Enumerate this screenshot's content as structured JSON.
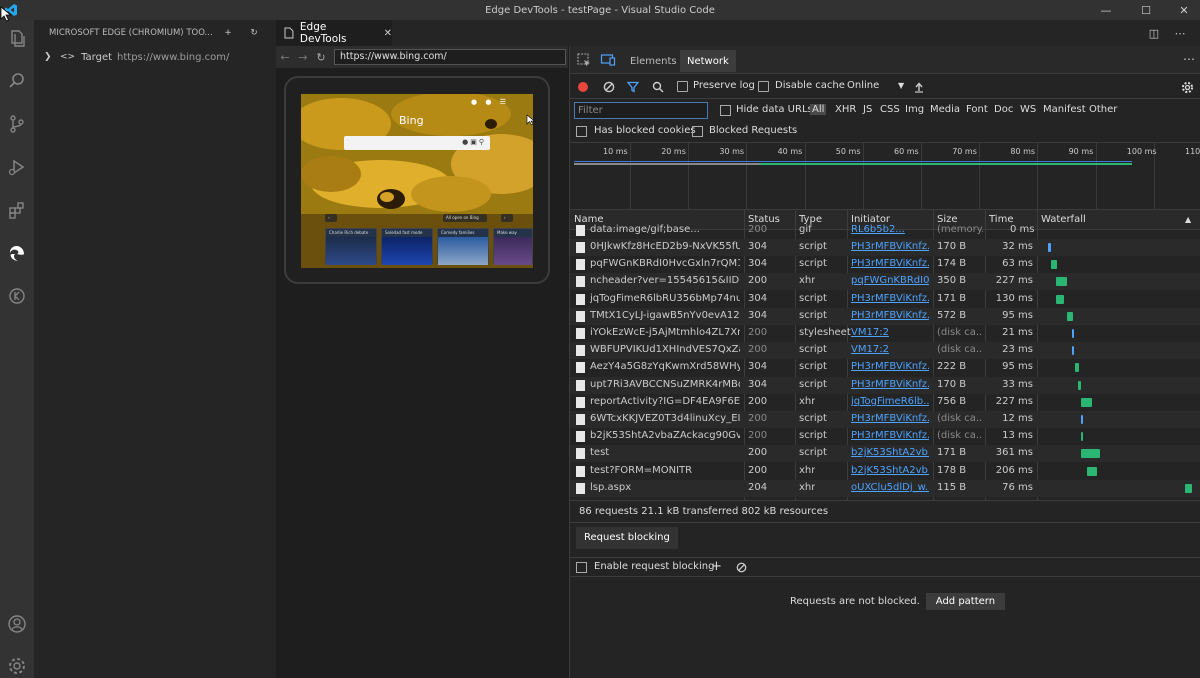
{
  "window": {
    "title": "Edge DevTools - testPage - Visual Studio Code"
  },
  "sidebar": {
    "title": "MICROSOFT EDGE (CHROMIUM) TOO...",
    "target_label": "Target",
    "target_url": "https://www.bing.com/"
  },
  "editor": {
    "tab_label": "Edge DevTools"
  },
  "screencast": {
    "url": "https://www.bing.com/",
    "bing_label": "Bing",
    "tiles": [
      "Charlie Rich debate",
      "Soledad fast mode",
      "Comedy families",
      "Make way"
    ],
    "strip_label": "All open on Bing"
  },
  "devtools": {
    "tabs": [
      {
        "label": "Elements"
      },
      {
        "label": "Network"
      }
    ],
    "toolbar": {
      "preserve_log": "Preserve log",
      "disable_cache": "Disable cache",
      "throttle": "Online"
    },
    "filter": {
      "placeholder": "Filter",
      "hide_data_urls": "Hide data URLs",
      "types": [
        "All",
        "XHR",
        "JS",
        "CSS",
        "Img",
        "Media",
        "Font",
        "Doc",
        "WS",
        "Manifest",
        "Other"
      ],
      "has_blocked_cookies": "Has blocked cookies",
      "blocked_requests": "Blocked Requests"
    },
    "overview_ticks": [
      "10 ms",
      "20 ms",
      "30 ms",
      "40 ms",
      "50 ms",
      "60 ms",
      "70 ms",
      "80 ms",
      "90 ms",
      "100 ms",
      "110"
    ],
    "table": {
      "columns": [
        "Name",
        "Status",
        "Type",
        "Initiator",
        "Size",
        "Time",
        "Waterfall"
      ],
      "partial_row": {
        "name": "data:image/gif;base...",
        "status": "200",
        "type": "gif",
        "initiator": "RL6b5b2...",
        "size": "(memory...",
        "time": "0 ms"
      },
      "rows": [
        {
          "name": "0HJkwKfz8HcED2b9-NxVK55fUc...",
          "status": "304",
          "type": "script",
          "initiator": "PH3rMFBViKnfz...",
          "initiator_link": true,
          "size": "170 B",
          "time": "32 ms",
          "wf_color": "#4da3ff",
          "wf_start": 0.05,
          "wf_len": 0.02,
          "dim_status": false
        },
        {
          "name": "pqFWGnKBRdI0HvcGxln7rQM1S...",
          "status": "304",
          "type": "script",
          "initiator": "PH3rMFBViKnfz...",
          "initiator_link": true,
          "size": "174 B",
          "time": "63 ms",
          "wf_color": "#2bb673",
          "wf_start": 0.07,
          "wf_len": 0.04,
          "dim_status": false
        },
        {
          "name": "ncheader?ver=15545615&IID=S...",
          "status": "200",
          "type": "xhr",
          "initiator": "pqFWGnKBRdI0...",
          "initiator_link": true,
          "size": "350 B",
          "time": "227 ms",
          "wf_color": "#2bb673",
          "wf_start": 0.1,
          "wf_len": 0.07,
          "dim_status": false
        },
        {
          "name": "jqTogFimeR6lbRU356bMp74nuB...",
          "status": "304",
          "type": "script",
          "initiator": "PH3rMFBViKnfz...",
          "initiator_link": true,
          "size": "171 B",
          "time": "130 ms",
          "wf_color": "#2bb673",
          "wf_start": 0.1,
          "wf_len": 0.05,
          "dim_status": false
        },
        {
          "name": "TMtX1CyLJ-igawB5nYv0evA12S...",
          "status": "304",
          "type": "script",
          "initiator": "PH3rMFBViKnfz...",
          "initiator_link": true,
          "size": "572 B",
          "time": "95 ms",
          "wf_color": "#2bb673",
          "wf_start": 0.17,
          "wf_len": 0.04,
          "dim_status": false
        },
        {
          "name": "iYOkEzWcE-j5AjMtmhlo4ZL7Xn...",
          "status": "200",
          "type": "stylesheet",
          "initiator": "VM17:2",
          "initiator_link": true,
          "size": "(disk ca...",
          "time": "21 ms",
          "wf_color": "#4da3ff",
          "wf_start": 0.2,
          "wf_len": 0.015,
          "dim_status": true
        },
        {
          "name": "WBFUPVIKUd1XHIndVES7QxZaD...",
          "status": "200",
          "type": "script",
          "initiator": "VM17:2",
          "initiator_link": true,
          "size": "(disk ca...",
          "time": "23 ms",
          "wf_color": "#4da3ff",
          "wf_start": 0.2,
          "wf_len": 0.015,
          "dim_status": true
        },
        {
          "name": "AezY4a5G8zYqKwmXrd58WHyN...",
          "status": "304",
          "type": "script",
          "initiator": "PH3rMFBViKnfz...",
          "initiator_link": true,
          "size": "222 B",
          "time": "95 ms",
          "wf_color": "#2bb673",
          "wf_start": 0.22,
          "wf_len": 0.03,
          "dim_status": false
        },
        {
          "name": "upt7Ri3AVBCCNSuZMRK4rMBq...",
          "status": "304",
          "type": "script",
          "initiator": "PH3rMFBViKnfz...",
          "initiator_link": true,
          "size": "170 B",
          "time": "33 ms",
          "wf_color": "#2bb673",
          "wf_start": 0.24,
          "wf_len": 0.02,
          "dim_status": false
        },
        {
          "name": "reportActivity?IG=DF4EA9F6EEA...",
          "status": "200",
          "type": "xhr",
          "initiator": "jqTogFimeR6lb...",
          "initiator_link": true,
          "size": "756 B",
          "time": "227 ms",
          "wf_color": "#2bb673",
          "wf_start": 0.26,
          "wf_len": 0.07,
          "dim_status": false
        },
        {
          "name": "6WTcxKKJVEZ0T3d4linuXcy_EIE.j...",
          "status": "200",
          "type": "script",
          "initiator": "PH3rMFBViKnfz...",
          "initiator_link": true,
          "size": "(disk ca...",
          "time": "12 ms",
          "wf_color": "#4da3ff",
          "wf_start": 0.26,
          "wf_len": 0.015,
          "dim_status": true
        },
        {
          "name": "b2jK53ShtA2vbaZAckacg90Gv6k...",
          "status": "200",
          "type": "script",
          "initiator": "PH3rMFBViKnfz...",
          "initiator_link": true,
          "size": "(disk ca...",
          "time": "13 ms",
          "wf_color": "#2bb673",
          "wf_start": 0.26,
          "wf_len": 0.015,
          "dim_status": true
        },
        {
          "name": "test",
          "status": "200",
          "type": "script",
          "initiator": "b2jK53ShtA2vb...",
          "initiator_link": true,
          "size": "171 B",
          "time": "361 ms",
          "wf_color": "#2bb673",
          "wf_start": 0.26,
          "wf_len": 0.12,
          "dim_status": false
        },
        {
          "name": "test?FORM=MONITR",
          "status": "200",
          "type": "xhr",
          "initiator": "b2jK53ShtA2vb...",
          "initiator_link": true,
          "size": "178 B",
          "time": "206 ms",
          "wf_color": "#2bb673",
          "wf_start": 0.3,
          "wf_len": 0.06,
          "dim_status": false
        },
        {
          "name": "lsp.aspx",
          "status": "204",
          "type": "xhr",
          "initiator": "oUXClu5dlDj_w...",
          "initiator_link": true,
          "size": "115 B",
          "time": "76 ms",
          "wf_color": "#2bb673",
          "wf_start": 0.92,
          "wf_len": 0.04,
          "dim_status": false
        }
      ]
    },
    "summary": "86 requests  21.1 kB transferred  802 kB resources",
    "drawer": {
      "tab": "Request blocking",
      "enable_label": "Enable request blocking",
      "empty_text": "Requests are not blocked.",
      "add_pattern": "Add pattern"
    }
  },
  "colors": {
    "accent": "#007acc",
    "record_red": "#e8453c",
    "filter_blue": "#4da3ff",
    "link_blue": "#4da3ff",
    "waterfall_green": "#2bb673"
  }
}
